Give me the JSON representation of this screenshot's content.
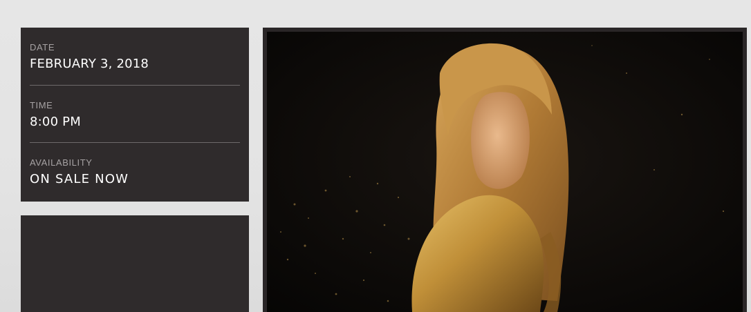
{
  "event": {
    "date_label": "DATE",
    "date_value": "FEBRUARY 3, 2018",
    "time_label": "TIME",
    "time_value": "8:00 PM",
    "availability_label": "AVAILABILITY",
    "availability_value": "ON SALE NOW"
  },
  "hero": {
    "image": "portrait-photo"
  },
  "colors": {
    "panel": "#2f2b2c",
    "page_bg": "#e5e5e5",
    "label": "#a7a3a4",
    "value": "#ffffff"
  }
}
